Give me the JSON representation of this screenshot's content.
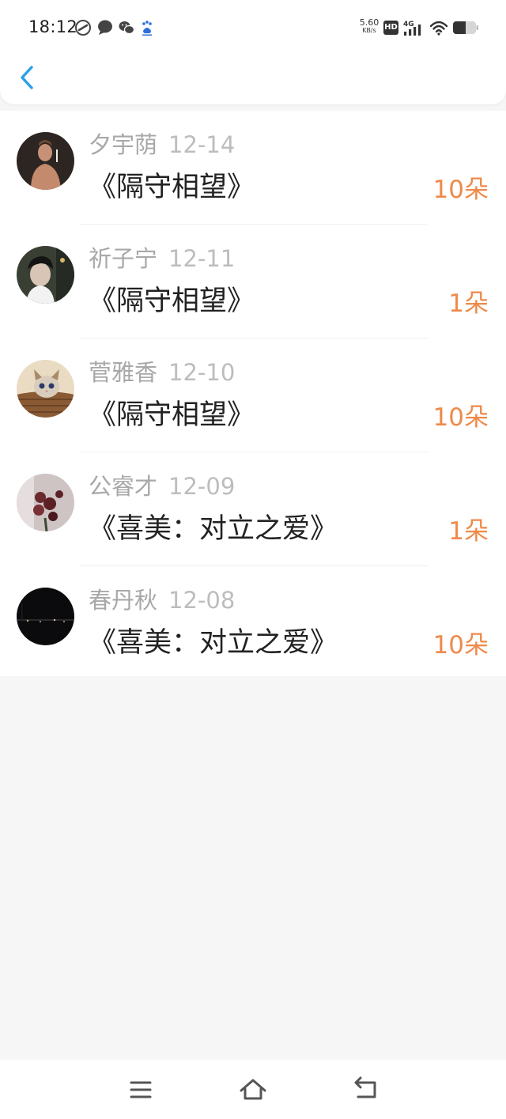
{
  "status_bar": {
    "time": "18:12",
    "net_speed_value": "5.60",
    "net_speed_unit": "KB/s",
    "hd_label": "HD",
    "network_label": "4G",
    "notification_icons": [
      "sync-icon",
      "message-icon",
      "wechat-icon",
      "baidu-icon"
    ],
    "battery_level": 0.55
  },
  "header": {
    "back_icon": "chevron-left-icon"
  },
  "items": [
    {
      "name": "夕宇荫",
      "date": "12-14",
      "title": "《隔守相望》",
      "amount": "10朵",
      "avatar": "shirtless-man-photo"
    },
    {
      "name": "祈子宁",
      "date": "12-11",
      "title": "《隔守相望》",
      "amount": "1朵",
      "avatar": "boy-portrait-photo"
    },
    {
      "name": "菅雅香",
      "date": "12-10",
      "title": "《隔守相望》",
      "amount": "10朵",
      "avatar": "kitten-in-basket-photo"
    },
    {
      "name": "公睿才",
      "date": "12-09",
      "title": "《喜美：对立之爱》",
      "amount": "1朵",
      "avatar": "roses-photo"
    },
    {
      "name": "春丹秋",
      "date": "12-08",
      "title": "《喜美：对立之爱》",
      "amount": "10朵",
      "avatar": "night-city-photo"
    }
  ],
  "nav": {
    "menu_icon": "menu-icon",
    "home_icon": "home-icon",
    "back_icon": "back-arrow-icon"
  },
  "colors": {
    "accent_back": "#2aa0e8",
    "amount": "#ee8a4a",
    "name": "#a8a8a8",
    "title": "#222222",
    "background": "#f7f6f7"
  }
}
